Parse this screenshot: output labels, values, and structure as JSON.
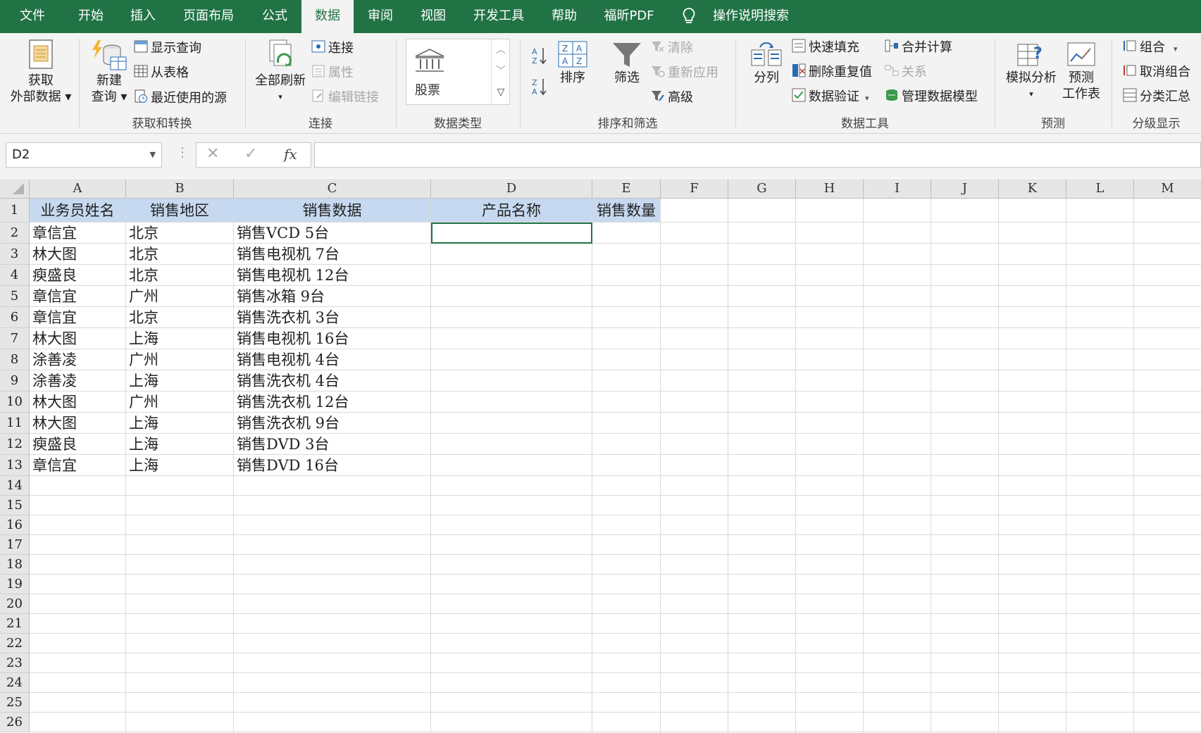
{
  "tabs": [
    {
      "label": "文件"
    },
    {
      "label": "开始"
    },
    {
      "label": "插入"
    },
    {
      "label": "页面布局"
    },
    {
      "label": "公式"
    },
    {
      "label": "数据"
    },
    {
      "label": "审阅"
    },
    {
      "label": "视图"
    },
    {
      "label": "开发工具"
    },
    {
      "label": "帮助"
    },
    {
      "label": "福昕PDF"
    }
  ],
  "search_label": "操作说明搜索",
  "ribbon": {
    "get_data": {
      "line1": "获取",
      "line2": "外部数据"
    },
    "new_query": {
      "line1": "新建",
      "line2": "查询"
    },
    "show_queries": "显示查询",
    "from_table": "从表格",
    "recent_sources": "最近使用的源",
    "group_get_transform": "获取和转换",
    "refresh_all": "全部刷新",
    "connections": "连接",
    "properties": "属性",
    "edit_links": "编辑链接",
    "group_connections": "连接",
    "stocks": "股票",
    "group_data_types": "数据类型",
    "sort": "排序",
    "filter": "筛选",
    "clear": "清除",
    "reapply": "重新应用",
    "advanced": "高级",
    "group_sort_filter": "排序和筛选",
    "text_to_columns": "分列",
    "flash_fill": "快速填充",
    "remove_duplicates": "删除重复值",
    "data_validation": "数据验证",
    "consolidate": "合并计算",
    "relationships": "关系",
    "manage_model": "管理数据模型",
    "group_data_tools": "数据工具",
    "what_if": "模拟分析",
    "forecast_sheet": {
      "line1": "预测",
      "line2": "工作表"
    },
    "group_forecast": "预测",
    "group": "组合",
    "ungroup": "取消组合",
    "subtotal": "分类汇总",
    "group_outline": "分级显示"
  },
  "name_box": "D2",
  "fx_symbol": "fx",
  "columns": [
    "A",
    "B",
    "C",
    "D",
    "E",
    "F",
    "G",
    "H",
    "I",
    "J",
    "K",
    "L",
    "M"
  ],
  "row_numbers": [
    "1",
    "2",
    "3",
    "4",
    "5",
    "6",
    "7",
    "8",
    "9",
    "10",
    "11",
    "12",
    "13",
    "14",
    "15",
    "16",
    "17",
    "18",
    "19",
    "20",
    "21",
    "22",
    "23",
    "24",
    "25",
    "26"
  ],
  "header_row": [
    "业务员姓名",
    "销售地区",
    "销售数据",
    "产品名称",
    "销售数量"
  ],
  "data_rows": [
    [
      "章信宜",
      "北京",
      "销售VCD 5台"
    ],
    [
      "林大图",
      "北京",
      "销售电视机 7台"
    ],
    [
      "瘐盛良",
      "北京",
      "销售电视机 12台"
    ],
    [
      "章信宜",
      "广州",
      "销售冰箱 9台"
    ],
    [
      "章信宜",
      "北京",
      "销售洗衣机 3台"
    ],
    [
      "林大图",
      "上海",
      "销售电视机 16台"
    ],
    [
      "涂善凌",
      "广州",
      "销售电视机 4台"
    ],
    [
      "涂善凌",
      "上海",
      "销售洗衣机 4台"
    ],
    [
      "林大图",
      "广州",
      "销售洗衣机 12台"
    ],
    [
      "林大图",
      "上海",
      "销售洗衣机 9台"
    ],
    [
      "瘐盛良",
      "上海",
      "销售DVD 3台"
    ],
    [
      "章信宜",
      "上海",
      "销售DVD 16台"
    ]
  ],
  "colors": {
    "accent": "#217346",
    "header_fill": "#c6d9f0"
  }
}
